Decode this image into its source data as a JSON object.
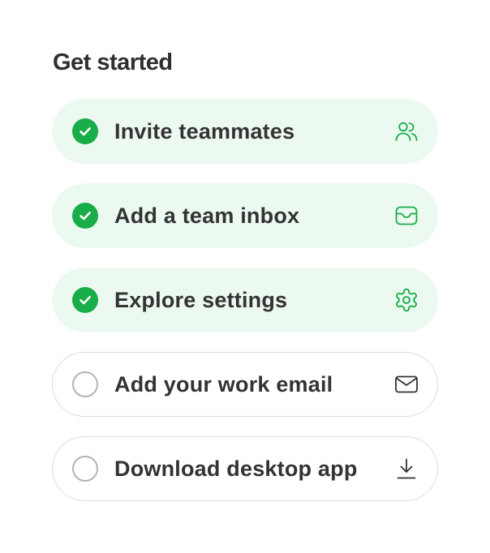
{
  "header": {
    "title": "Get started"
  },
  "colors": {
    "accent_green": "#18ad48",
    "done_background": "#ecf9f0",
    "todo_border": "#dcdcdc",
    "text": "#333333"
  },
  "checklist": {
    "items": [
      {
        "label": "Invite teammates",
        "completed": true,
        "icon": "users-icon"
      },
      {
        "label": "Add a team inbox",
        "completed": true,
        "icon": "inbox-icon"
      },
      {
        "label": "Explore settings",
        "completed": true,
        "icon": "gear-icon"
      },
      {
        "label": "Add your work email",
        "completed": false,
        "icon": "mail-icon"
      },
      {
        "label": "Download desktop app",
        "completed": false,
        "icon": "download-icon"
      }
    ]
  }
}
